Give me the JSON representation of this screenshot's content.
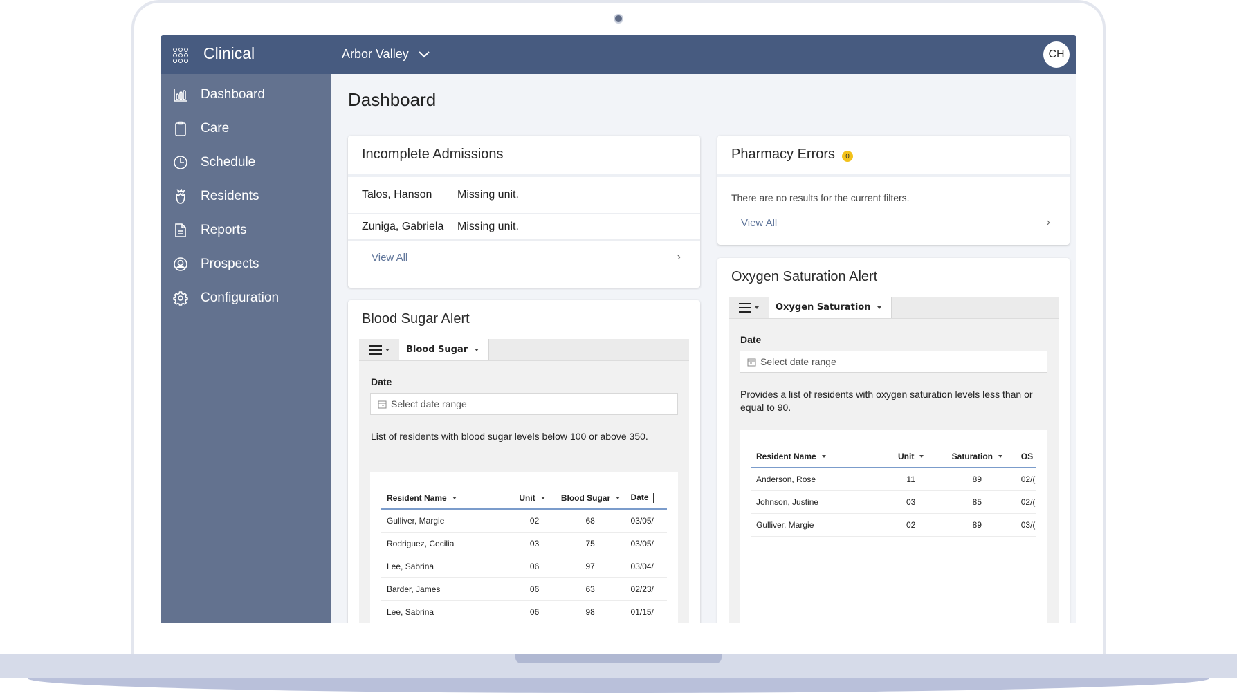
{
  "app": {
    "brand": "Clinical",
    "facility": "Arbor Valley",
    "user_initials": "CH"
  },
  "sidebar": {
    "items": [
      {
        "label": "Dashboard",
        "icon": "bar-chart-icon"
      },
      {
        "label": "Care",
        "icon": "clipboard-icon"
      },
      {
        "label": "Schedule",
        "icon": "clock-icon"
      },
      {
        "label": "Residents",
        "icon": "flower-icon"
      },
      {
        "label": "Reports",
        "icon": "document-icon"
      },
      {
        "label": "Prospects",
        "icon": "user-circle-icon"
      },
      {
        "label": "Configuration",
        "icon": "gear-icon"
      }
    ]
  },
  "page": {
    "title": "Dashboard"
  },
  "incomplete_admissions": {
    "title": "Incomplete Admissions",
    "rows": [
      {
        "name": "Talos, Hanson",
        "issue": "Missing unit."
      },
      {
        "name": "Zuniga, Gabriela",
        "issue": "Missing unit."
      }
    ],
    "view_all": "View All"
  },
  "pharmacy_errors": {
    "title": "Pharmacy Errors",
    "count": "0",
    "empty_message": "There are no results for the current filters.",
    "view_all": "View All"
  },
  "blood_sugar": {
    "title": "Blood Sugar Alert",
    "tab": "Blood Sugar",
    "filter_label": "Date",
    "date_placeholder": "Select date range",
    "description": "List of residents with blood sugar levels below 100 or above 350.",
    "columns": [
      "Resident Name",
      "Unit",
      "Blood Sugar",
      "Date"
    ],
    "rows": [
      [
        "Gulliver, Margie",
        "02",
        "68",
        "03/05/"
      ],
      [
        "Rodriguez, Cecilia",
        "03",
        "75",
        "03/05/"
      ],
      [
        "Lee, Sabrina",
        "06",
        "97",
        "03/04/"
      ],
      [
        "Barder, James",
        "06",
        "63",
        "02/23/"
      ],
      [
        "Lee, Sabrina",
        "06",
        "98",
        "01/15/"
      ]
    ]
  },
  "oxygen": {
    "title": "Oxygen Saturation Alert",
    "tab": "Oxygen Saturation",
    "filter_label": "Date",
    "date_placeholder": "Select date range",
    "description": "Provides a list of residents with oxygen saturation levels less than or equal to 90.",
    "columns": [
      "Resident Name",
      "Unit",
      "Saturation",
      "OS"
    ],
    "rows": [
      [
        "Anderson, Rose",
        "11",
        "89",
        "02/("
      ],
      [
        "Johnson, Justine",
        "03",
        "85",
        "02/("
      ],
      [
        "Gulliver, Margie",
        "02",
        "89",
        "03/("
      ]
    ]
  },
  "colors": {
    "topbar": "#475b80",
    "sidebar": "#63728f",
    "link": "#5f759a",
    "badge": "#f3c21b",
    "grid_header_rule": "#7b9ccb"
  }
}
